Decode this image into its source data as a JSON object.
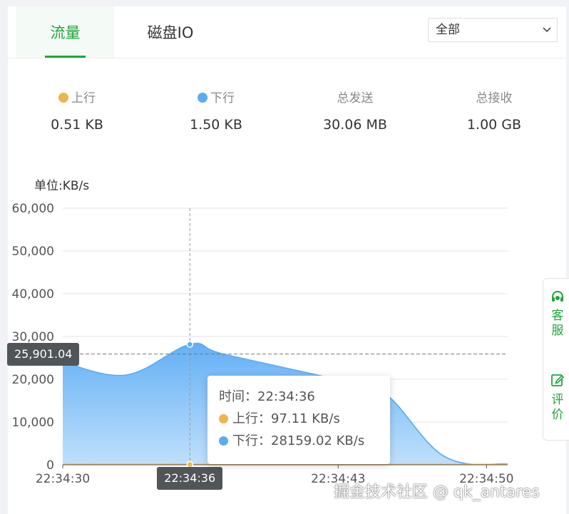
{
  "tabs": [
    {
      "label": "流量",
      "active": true
    },
    {
      "label": "磁盘IO",
      "active": false
    }
  ],
  "filter": {
    "selected": "全部"
  },
  "stats": [
    {
      "label": "上行",
      "value": "0.51 KB",
      "dot": "#f0b44c"
    },
    {
      "label": "下行",
      "value": "1.50 KB",
      "dot": "#5aabf5"
    },
    {
      "label": "总发送",
      "value": "30.06 MB"
    },
    {
      "label": "总接收",
      "value": "1.00 GB"
    }
  ],
  "chart_data": {
    "type": "area",
    "unit_label": "单位:KB/s",
    "ylim": [
      0,
      60000
    ],
    "yticks": [
      0,
      10000,
      20000,
      30000,
      40000,
      50000,
      60000
    ],
    "ytick_labels": [
      "0",
      "10,000",
      "20,000",
      "30,000",
      "40,000",
      "50,000",
      "60,000"
    ],
    "xticks": [
      "22:34:30",
      "22:34:43",
      "22:34:50"
    ],
    "xlim_seconds": [
      0,
      21
    ],
    "grid": true,
    "series": [
      {
        "name": "上行",
        "color": "#f0b44c",
        "x": [
          0,
          3,
          6,
          9,
          12,
          15,
          18,
          21
        ],
        "y": [
          100,
          100,
          97.11,
          90,
          90,
          90,
          80,
          80
        ]
      },
      {
        "name": "下行",
        "color": "#5aabf5",
        "x": [
          0,
          3,
          6,
          7.5,
          12,
          15,
          18,
          21
        ],
        "y": [
          24000,
          21000,
          28159.02,
          26000,
          21000,
          17500,
          2000,
          200
        ]
      }
    ],
    "crosshair": {
      "x_label": "22:34:36",
      "y_label": "25,901.04",
      "x_seconds": 6,
      "y_value": 25901.04
    },
    "tooltip": {
      "time_label": "时间：",
      "time": "22:34:36",
      "rows": [
        {
          "name": "上行：",
          "value": "97.11 KB/s",
          "color": "#f0b44c"
        },
        {
          "name": "下行：",
          "value": "28159.02 KB/s",
          "color": "#5aabf5"
        }
      ]
    }
  },
  "side_float": {
    "service": {
      "label": "客服",
      "chars": [
        "客",
        "服"
      ]
    },
    "review": {
      "label": "评价",
      "chars": [
        "评",
        "价"
      ]
    }
  },
  "watermark": "掘金技术社区 @ qk_antares",
  "colors": {
    "accent": "#20a53a",
    "badge": "#505558"
  }
}
